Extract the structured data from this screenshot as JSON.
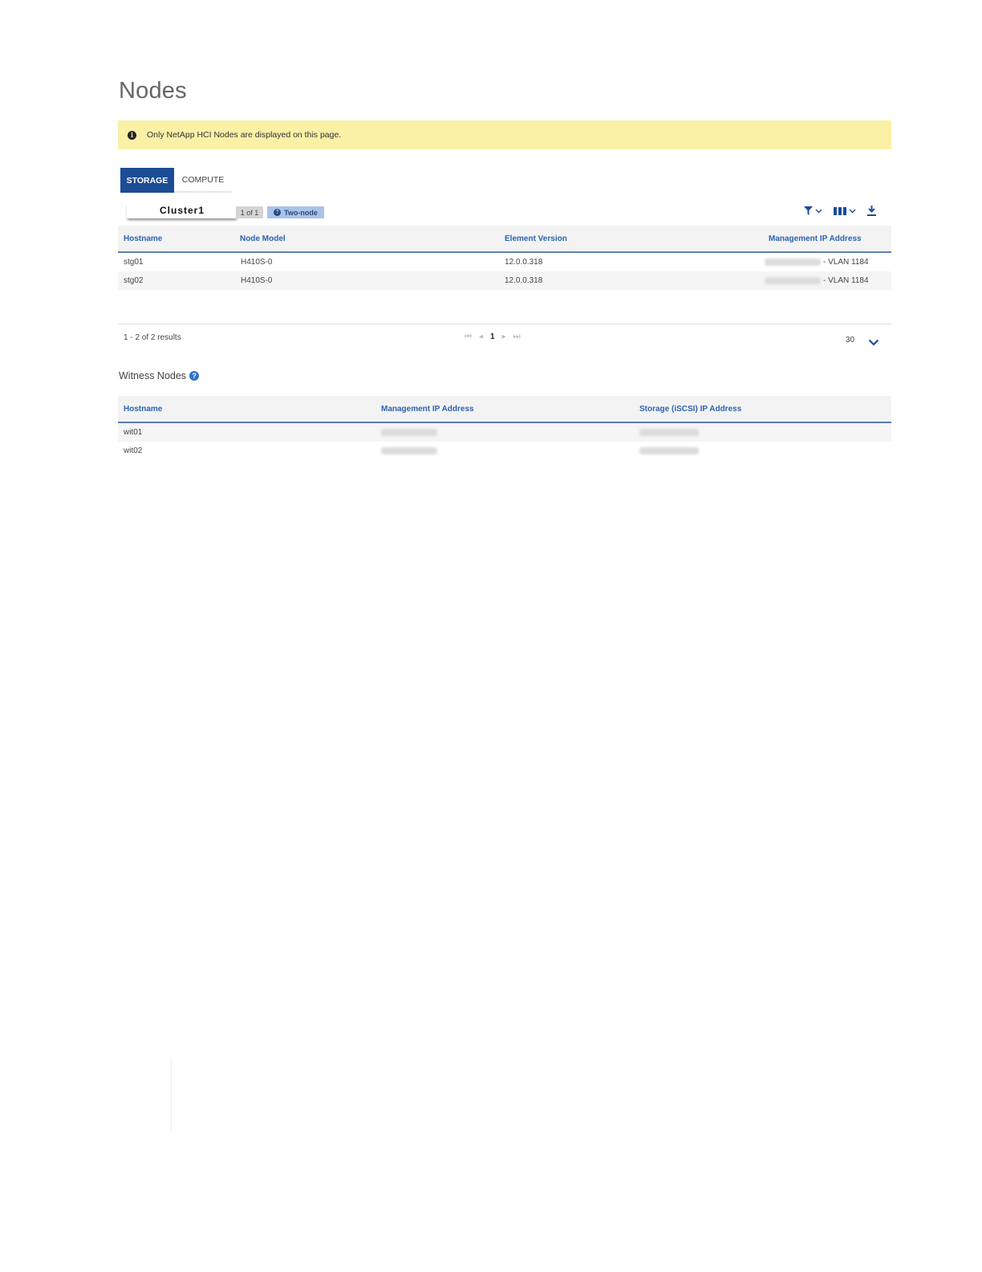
{
  "page": {
    "title": "Nodes"
  },
  "banner": {
    "message": "Only NetApp HCI Nodes are displayed on this page.",
    "icon": "info-icon"
  },
  "tabs": [
    {
      "label": "STORAGE",
      "active": true
    },
    {
      "label": "COMPUTE",
      "active": false
    }
  ],
  "cluster": {
    "name": "Cluster1",
    "count": "1 of 1",
    "mode": "Two-node"
  },
  "toolbar": {
    "icons": [
      "filter-icon",
      "columns-icon",
      "download-icon"
    ]
  },
  "storage_table": {
    "columns": [
      "Hostname",
      "Node Model",
      "Element Version",
      "Management IP Address"
    ],
    "rows": [
      {
        "hostname": "stg01",
        "model": "H410S-0",
        "version": "12.0.0.318",
        "ip_suffix": "- VLAN 1184"
      },
      {
        "hostname": "stg02",
        "model": "H410S-0",
        "version": "12.0.0.318",
        "ip_suffix": "- VLAN 1184"
      }
    ]
  },
  "pagination": {
    "results": "1 - 2 of 2 results",
    "current_page": "1",
    "per_page": "30"
  },
  "witness": {
    "title": "Witness Nodes",
    "columns": [
      "Hostname",
      "Management IP Address",
      "Storage (iSCSI) IP Address"
    ],
    "rows": [
      {
        "hostname": "wit01"
      },
      {
        "hostname": "wit02"
      }
    ]
  },
  "colors": {
    "accent": "#1c4c96",
    "header_text": "#2d62b0",
    "banner": "#faf0a6",
    "badge": "#a9c3e8"
  }
}
